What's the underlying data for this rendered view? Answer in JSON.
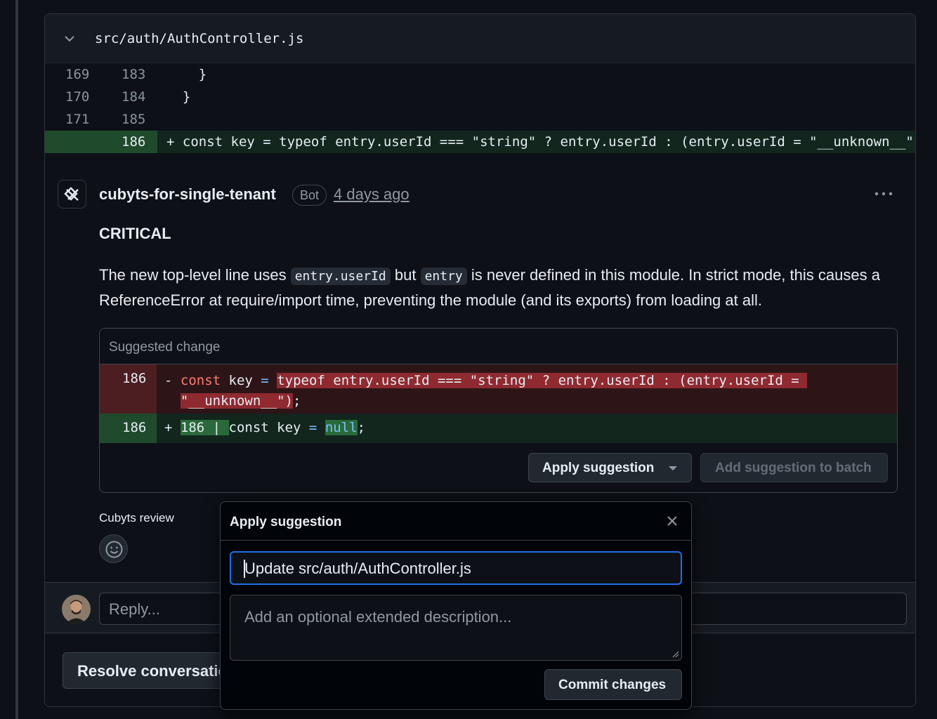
{
  "file": {
    "name": "src/auth/AuthController.js"
  },
  "diff_rows": [
    {
      "old": "169",
      "new": "183",
      "code": "    }",
      "added": false
    },
    {
      "old": "170",
      "new": "184",
      "code": "  }",
      "added": false
    },
    {
      "old": "171",
      "new": "185",
      "code": "",
      "added": false
    },
    {
      "old": "",
      "new": "186",
      "code": "+ const key = typeof entry.userId === \"string\" ? entry.userId : (entry.userId = \"__unknown__\"",
      "added": true
    }
  ],
  "comment": {
    "author": "cubyts-for-single-tenant",
    "badge": "Bot",
    "time": "4 days ago",
    "severity": "CRITICAL",
    "para_1": "The new top-level line uses ",
    "code_1": "entry.userId",
    "para_2": " but ",
    "code_2": "entry",
    "para_3": " is never defined in this module. In strict mode, this causes a ReferenceError at require/import time, preventing the module (and its exports) from loading at all."
  },
  "suggestion": {
    "title": "Suggested change",
    "del_line_no": "186",
    "del_prefix": "- ",
    "del_kw": "const",
    "del_key": " key ",
    "del_eq": "=",
    "del_hl_1": "typeof entry.userId === \"string\" ? entry.userId : (entry.userId = ",
    "del_hl_2": "\"__unknown__\")",
    "del_semicolon": ";",
    "add_line_no": "186",
    "add_prefix": "+ ",
    "add_hl": "186 | ",
    "add_code": "const key ",
    "add_eq": "=",
    "add_null": "null",
    "add_semicolon": ";",
    "apply_label": "Apply suggestion",
    "batch_label": "Add suggestion to batch"
  },
  "review": {
    "label": "Cubyts review"
  },
  "reply": {
    "placeholder": "Reply..."
  },
  "resolve": {
    "label": "Resolve conversation"
  },
  "popover": {
    "title": "Apply suggestion",
    "commit_message": "Update src/auth/AuthController.js",
    "description_placeholder": "Add an optional extended description...",
    "commit_label": "Commit changes"
  },
  "colors": {
    "accent": "#1f6feb",
    "added_bg": "#12261e",
    "deleted_bg": "#2d1517"
  }
}
